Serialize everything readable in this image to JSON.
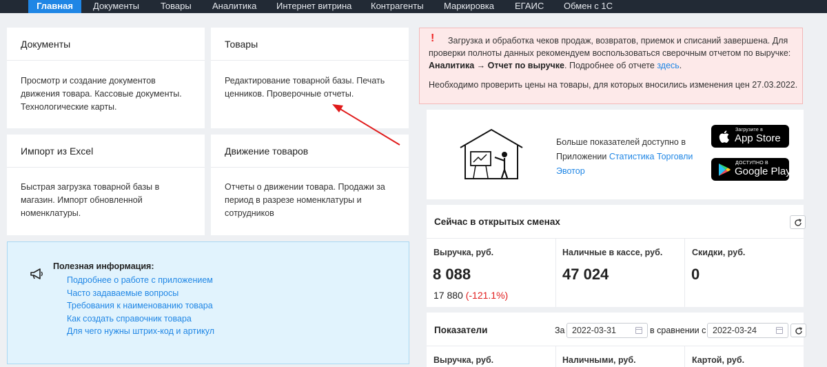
{
  "nav": {
    "tabs": [
      {
        "label": "Главная",
        "active": true
      },
      {
        "label": "Документы"
      },
      {
        "label": "Товары"
      },
      {
        "label": "Аналитика"
      },
      {
        "label": "Интернет витрина"
      },
      {
        "label": "Контрагенты"
      },
      {
        "label": "Маркировка"
      },
      {
        "label": "ЕГАИС"
      },
      {
        "label": "Обмен с 1С"
      }
    ]
  },
  "cards": [
    {
      "title": "Документы",
      "body": "Просмотр и создание документов движения товара. Кассовые документы. Технологические карты."
    },
    {
      "title": "Товары",
      "body": "Редактирование товарной базы. Печать ценников. Проверочные отчеты."
    },
    {
      "title": "Импорт из Excel",
      "body": "Быстрая загрузка товарной базы в магазин. Импорт обновленной номенклатуры."
    },
    {
      "title": "Движение товаров",
      "body": "Отчеты о движении товара. Продажи за период в разрезе номенклатуры и сотрудников"
    }
  ],
  "info": {
    "title": "Полезная информация:",
    "links": [
      "Подробнее о работе с приложением",
      "Часто задаваемые вопросы",
      "Требования к наименованию товара",
      "Как создать справочник товара",
      "Для чего нужны штрих-код и артикул"
    ]
  },
  "alert": {
    "mark": "!",
    "text1": "Загрузка и обработка чеков продаж, возвратов, приемок и списаний завершена. Для проверки полноты данных рекомендуем воспользоваться сверочным отчетом по выручке: ",
    "bold": "Аналитика → Отчет по выручке",
    "text2": ". Подробнее об отчете ",
    "link": "здесь",
    "text3": ".",
    "text4": "Необходимо проверить цены на товары, для которых вносились изменения цен 27.03.2022."
  },
  "promo": {
    "text": "Больше показателей доступно в Приложении ",
    "link": "Статистика Торговли Эвотор",
    "appstore_small": "Загрузите в",
    "appstore_big": "App Store",
    "gplay_small": "ДОСТУПНО В",
    "gplay_big": "Google Play"
  },
  "shifts": {
    "title": "Сейчас в открытых сменах",
    "metrics": [
      {
        "label": "Выручка, руб.",
        "value": "8 088",
        "sub": "17 880",
        "sub_change": "(-121.1%)"
      },
      {
        "label": "Наличные в кассе, руб.",
        "value": "47 024"
      },
      {
        "label": "Скидки, руб.",
        "value": "0"
      }
    ]
  },
  "indicators": {
    "title": "Показатели",
    "za": "За",
    "date1": "2022-03-31",
    "compare": "в сравнении с",
    "date2": "2022-03-24",
    "metrics": [
      "Выручка, руб.",
      "Наличными, руб.",
      "Картой, руб."
    ]
  },
  "colors": {
    "accent": "#1f86e5",
    "nav_bg": "#222a35",
    "alert_bg": "#fde9e9",
    "info_bg": "#e1f3fd",
    "negative": "#e11d1d"
  }
}
